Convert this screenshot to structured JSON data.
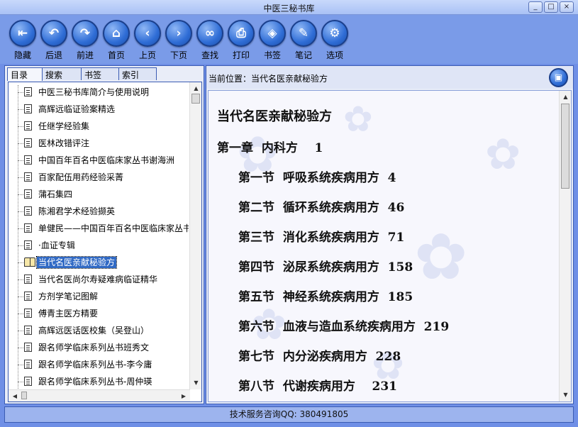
{
  "window": {
    "title": "中医三秘书库",
    "controls": [
      "_",
      "□",
      "×"
    ]
  },
  "toolbar": [
    {
      "id": "hide",
      "label": "隐藏",
      "icon": "hide-icon",
      "glyph": "⇤"
    },
    {
      "id": "back",
      "label": "后退",
      "icon": "back-arrow-icon",
      "glyph": "↶"
    },
    {
      "id": "forward",
      "label": "前进",
      "icon": "forward-arrow-icon",
      "glyph": "↷"
    },
    {
      "id": "home",
      "label": "首页",
      "icon": "home-icon",
      "glyph": "⌂"
    },
    {
      "id": "prev",
      "label": "上页",
      "icon": "chevron-left-icon",
      "glyph": "‹"
    },
    {
      "id": "next",
      "label": "下页",
      "icon": "chevron-right-icon",
      "glyph": "›"
    },
    {
      "id": "find",
      "label": "查找",
      "icon": "binoculars-icon",
      "glyph": "∞"
    },
    {
      "id": "print",
      "label": "打印",
      "icon": "printer-icon",
      "glyph": "⎙"
    },
    {
      "id": "bookmark",
      "label": "书签",
      "icon": "tag-icon",
      "glyph": "◈"
    },
    {
      "id": "notes",
      "label": "笔记",
      "icon": "notepad-icon",
      "glyph": "✎"
    },
    {
      "id": "options",
      "label": "选项",
      "icon": "gear-icon",
      "glyph": "⚙"
    }
  ],
  "left_tabs": [
    "目录",
    "搜索",
    "书签",
    "索引"
  ],
  "tree": {
    "items": [
      "中医三秘书库简介与使用说明",
      "高辉远临证验案精选",
      "任继学经验集",
      "医林改错评注",
      "中国百年百名中医临床家丛书谢海洲",
      "百家配伍用药经验采菁",
      "蒲石集四",
      "陈湘君学术经验撷英",
      "单健民——中国百年百名中医临床家丛书",
      "·血证专辑",
      "当代名医亲献秘验方",
      "当代名医尚尔寿疑难病临证精华",
      "方剂学笔记图解",
      "傅青主医方精要",
      "高辉远医话医校集（吴登山）",
      "跟名师学临床系列丛书班秀文",
      "跟名师学临床系列丛书-李今庸",
      "跟名师学临床系列丛书-周仲瑛"
    ],
    "selected_index": 10
  },
  "location": {
    "label": "当前位置：当代名医亲献秘验方"
  },
  "content": {
    "title": "当代名医亲献秘验方",
    "lines": [
      {
        "text": "第一章  内科方    1",
        "indent": 0
      },
      {
        "text": "第一节  呼吸系统疾病用方  4",
        "indent": 1
      },
      {
        "text": "第二节  循环系统疾病用方  46",
        "indent": 1
      },
      {
        "text": "第三节  消化系统疾病用方  71",
        "indent": 1
      },
      {
        "text": "第四节  泌尿系统疾病用方  158",
        "indent": 1
      },
      {
        "text": "第五节  神经系统疾病用方  185",
        "indent": 1
      },
      {
        "text": "第六节  血液与造血系统疾病用方  219",
        "indent": 1
      },
      {
        "text": "第七节  内分泌疾病用方  228",
        "indent": 1
      },
      {
        "text": "第八节  代谢疾病用方    231",
        "indent": 1
      }
    ]
  },
  "status": {
    "text": "技术服务咨询QQ: 380491805"
  }
}
